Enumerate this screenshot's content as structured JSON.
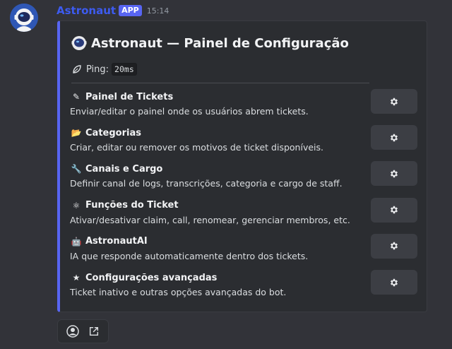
{
  "colors": {
    "background": "#323339",
    "embed_bg": "#2b2d31",
    "accent": "#5865f2",
    "username": "#3d5bf0",
    "button_bg": "#3c3e44"
  },
  "message": {
    "username": "Astronaut",
    "badge": "APP",
    "timestamp": "15:14",
    "avatar_icon": "astronaut-avatar"
  },
  "embed": {
    "title_icon": "astronaut-icon",
    "title": "Astronaut — Painel de Configuração",
    "ping_icon": "leaf-icon",
    "ping_label": "Ping:",
    "ping_value": "20ms",
    "items": [
      {
        "icon": "ticket-icon",
        "glyph": "✎",
        "title": "Painel de Tickets",
        "description": "Enviar/editar o painel onde os usuários abrem tickets.",
        "button_icon": "gear-icon"
      },
      {
        "icon": "folder-icon",
        "glyph": "📂",
        "title": "Categorias",
        "description": "Criar, editar ou remover os motivos de ticket disponíveis.",
        "button_icon": "gear-icon"
      },
      {
        "icon": "wrench-icon",
        "glyph": "🔧",
        "title": "Canais e Cargo",
        "description": "Definir canal de logs, transcrições, categoria e cargo de staff.",
        "button_icon": "gear-icon"
      },
      {
        "icon": "atom-icon",
        "glyph": "⚛",
        "title": "Funções do Ticket",
        "description": "Ativar/desativar claim, call, renomear, gerenciar membros, etc.",
        "button_icon": "gear-icon"
      },
      {
        "icon": "robot-icon",
        "glyph": "🤖",
        "title": "AstronautAI",
        "description": "IA que responde automaticamente dentro dos tickets.",
        "button_icon": "gear-icon"
      },
      {
        "icon": "star-icon",
        "glyph": "★",
        "title": "Configurações avançadas",
        "description": "Ticket inativo e outras opções avançadas do bot.",
        "button_icon": "gear-icon"
      }
    ]
  },
  "footer": {
    "icons": [
      "user-app-icon",
      "external-link-icon"
    ]
  }
}
